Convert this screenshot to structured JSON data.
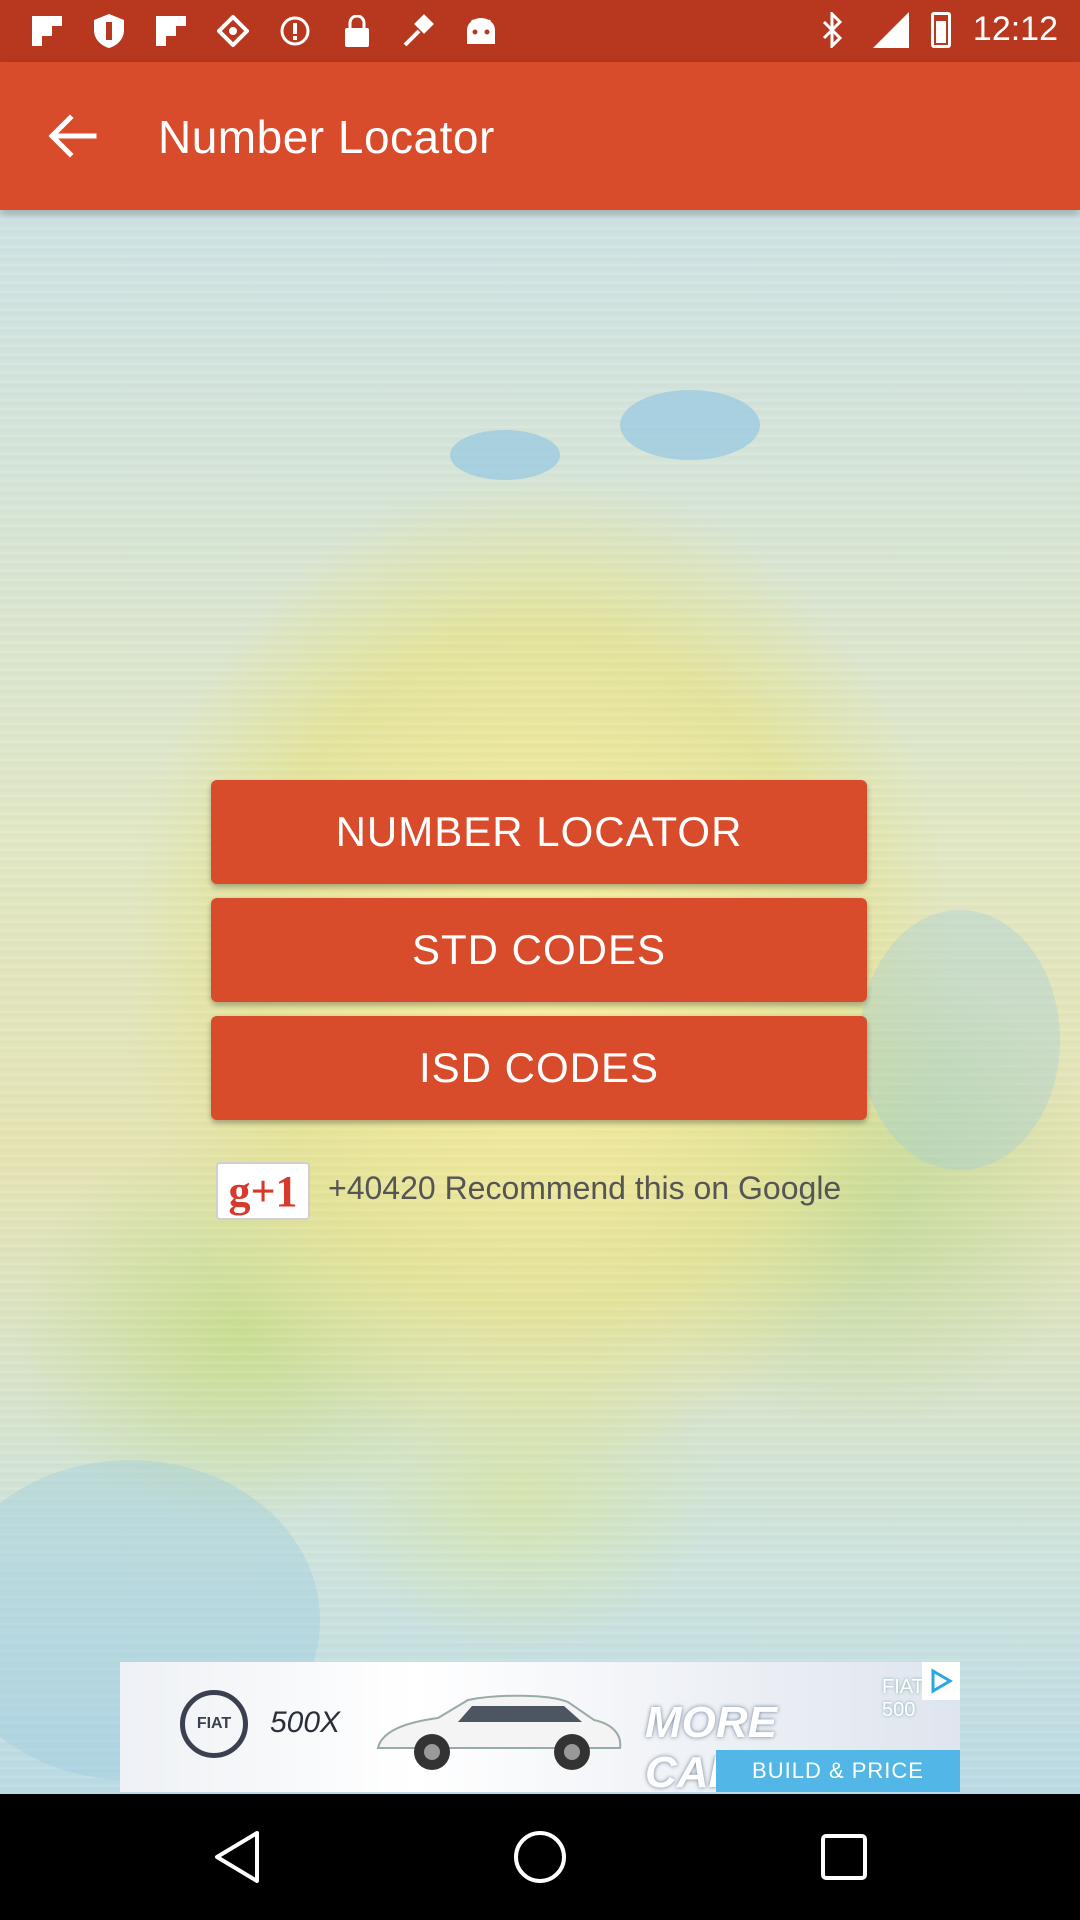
{
  "status_bar": {
    "time": "12:12",
    "left_icons": [
      "flipboard-icon",
      "shield-icon",
      "flipboard-icon",
      "diamond-icon",
      "alert-icon",
      "lock-icon",
      "fake-gps-icon",
      "android-icon"
    ],
    "right_icons": [
      "bluetooth-icon",
      "signal-icon",
      "battery-icon"
    ]
  },
  "app_bar": {
    "title": "Number Locator",
    "back_icon": "arrow-back-icon",
    "color": "#d84c2b"
  },
  "menu": {
    "number_locator": "NUMBER LOCATOR",
    "std_codes": "STD CODES",
    "isd_codes": "ISD CODES"
  },
  "google_plus": {
    "button_label": "g+1",
    "recommend_text": "+40420 Recommend this on Google"
  },
  "ad": {
    "brand_logo": "FIAT",
    "model": "500X",
    "badge": "FIAT® 500",
    "headline": "MORE CAPABLE",
    "cta": "BUILD & PRICE",
    "choice_icon": "ad-choices-icon"
  },
  "nav_bar": {
    "icons": [
      "back-triangle-icon",
      "home-circle-icon",
      "recents-square-icon"
    ]
  }
}
